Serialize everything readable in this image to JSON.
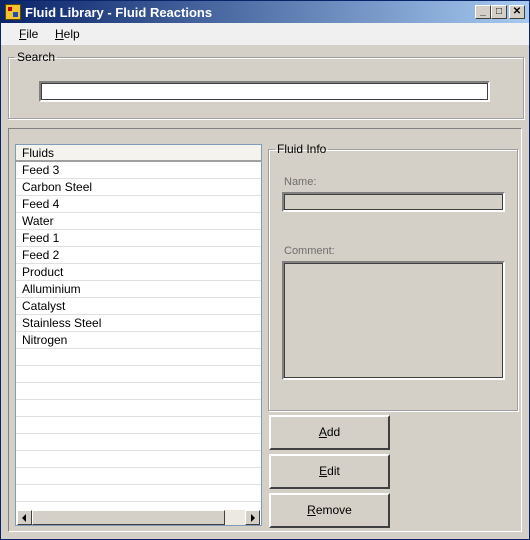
{
  "window": {
    "title": "Fluid Library - Fluid Reactions",
    "controls": {
      "minimize": "_",
      "maximize": "□",
      "close": "✕"
    }
  },
  "menu": {
    "items": [
      "File",
      "Help"
    ]
  },
  "search": {
    "legend": "Search",
    "value": ""
  },
  "list": {
    "header": "Fluids",
    "items": [
      "Feed 3",
      "Carbon Steel",
      "Feed 4",
      "Water",
      "Feed 1",
      "Feed 2",
      "Product",
      "Alluminium",
      "Catalyst",
      "Stainless Steel",
      "Nitrogen"
    ]
  },
  "info": {
    "legend": "Fluid Info",
    "name_label": "Name:",
    "name_value": "",
    "comment_label": "Comment:",
    "comment_value": ""
  },
  "buttons": {
    "add": "Add",
    "edit": "Edit",
    "remove": "Remove"
  }
}
